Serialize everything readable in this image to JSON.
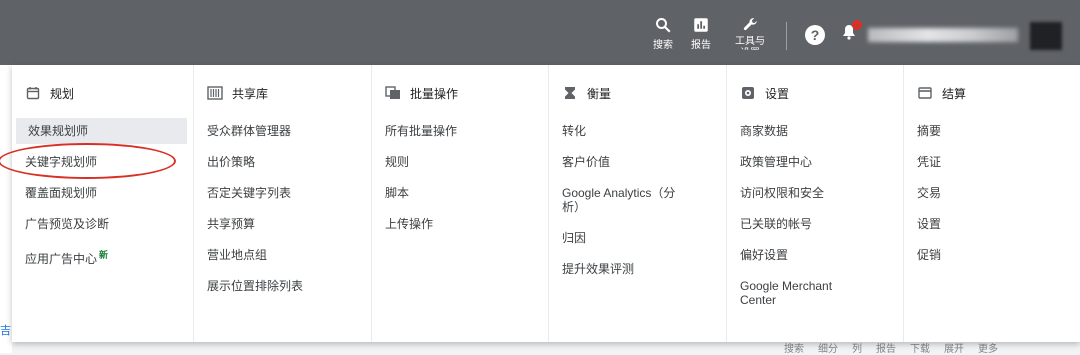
{
  "topbar": {
    "search_label": "搜索",
    "reports_label": "报告",
    "tools_label": "工具与\n设置",
    "help_glyph": "?"
  },
  "columns": [
    {
      "title": "规划",
      "icon": "calendar-icon",
      "items": [
        {
          "label": "效果规划师",
          "active": true
        },
        {
          "label": "关键字规划师"
        },
        {
          "label": "覆盖面规划师"
        },
        {
          "label": "广告预览及诊断"
        },
        {
          "label": "应用广告中心",
          "badge": "新"
        }
      ]
    },
    {
      "title": "共享库",
      "icon": "library-icon",
      "items": [
        {
          "label": "受众群体管理器"
        },
        {
          "label": "出价策略"
        },
        {
          "label": "否定关键字列表"
        },
        {
          "label": "共享预算"
        },
        {
          "label": "营业地点组"
        },
        {
          "label": "展示位置排除列表"
        }
      ]
    },
    {
      "title": "批量操作",
      "icon": "copy-icon",
      "items": [
        {
          "label": "所有批量操作"
        },
        {
          "label": "规则"
        },
        {
          "label": "脚本"
        },
        {
          "label": "上传操作"
        }
      ]
    },
    {
      "title": "衡量",
      "icon": "hourglass-icon",
      "items": [
        {
          "label": "转化"
        },
        {
          "label": "客户价值"
        },
        {
          "label": "Google Analytics（分析）"
        },
        {
          "label": "归因"
        },
        {
          "label": "提升效果评测"
        }
      ]
    },
    {
      "title": "设置",
      "icon": "settings-icon",
      "items": [
        {
          "label": "商家数据"
        },
        {
          "label": "政策管理中心"
        },
        {
          "label": "访问权限和安全"
        },
        {
          "label": "已关联的帐号"
        },
        {
          "label": "偏好设置"
        },
        {
          "label": "Google Merchant Center"
        }
      ]
    },
    {
      "title": "结算",
      "icon": "billing-icon",
      "items": [
        {
          "label": "摘要"
        },
        {
          "label": "凭证"
        },
        {
          "label": "交易"
        },
        {
          "label": "设置"
        },
        {
          "label": "促销"
        }
      ]
    }
  ],
  "background": {
    "left_link": "吉",
    "bottom_actions": [
      "搜索",
      "细分",
      "列",
      "报告",
      "下载",
      "展开",
      "更多"
    ]
  },
  "colors": {
    "topbar": "#5f6368",
    "highlight": "#d93025",
    "badge": "#188038"
  }
}
